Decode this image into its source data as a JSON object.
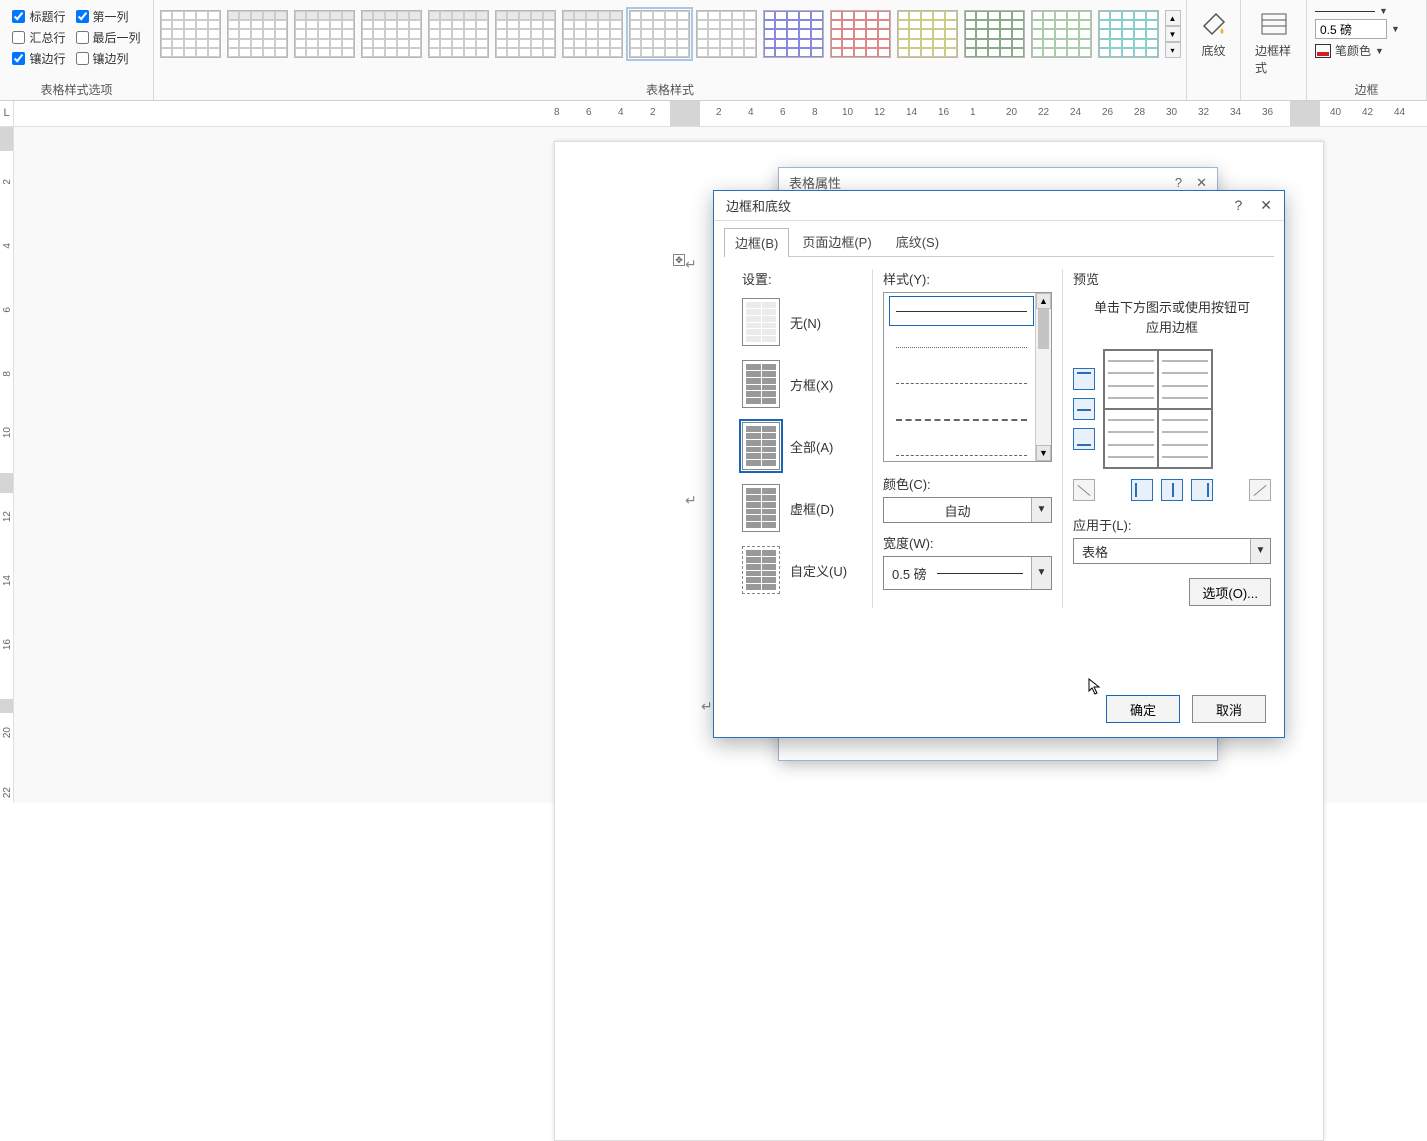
{
  "ribbon": {
    "options_group_label": "表格样式选项",
    "styles_group_label": "表格样式",
    "borders_group_label": "边框",
    "checks": {
      "header_row": "标题行",
      "first_col": "第一列",
      "total_row": "汇总行",
      "last_col": "最后一列",
      "banded_row": "镶边行",
      "banded_col": "镶边列"
    },
    "shading": "底纹",
    "border_styles": "边框样式",
    "width_value": "0.5 磅",
    "pen_color": "笔颜色"
  },
  "ruler": {
    "corner": "L"
  },
  "back_dialog": {
    "title": "表格属性"
  },
  "dialog": {
    "title": "边框和底纹",
    "tabs": {
      "borders": "边框(B)",
      "page": "页面边框(P)",
      "shading": "底纹(S)"
    },
    "settings_label": "设置:",
    "settings": {
      "none": "无(N)",
      "box": "方框(X)",
      "all": "全部(A)",
      "grid": "虚框(D)",
      "custom": "自定义(U)"
    },
    "style_label": "样式(Y):",
    "color_label": "颜色(C):",
    "color_value": "自动",
    "width_label": "宽度(W):",
    "width_value": "0.5 磅",
    "preview_label": "预览",
    "preview_hint1": "单击下方图示或使用按钮可",
    "preview_hint2": "应用边框",
    "apply_label": "应用于(L):",
    "apply_value": "表格",
    "options_btn": "选项(O)...",
    "ok": "确定",
    "cancel": "取消"
  }
}
